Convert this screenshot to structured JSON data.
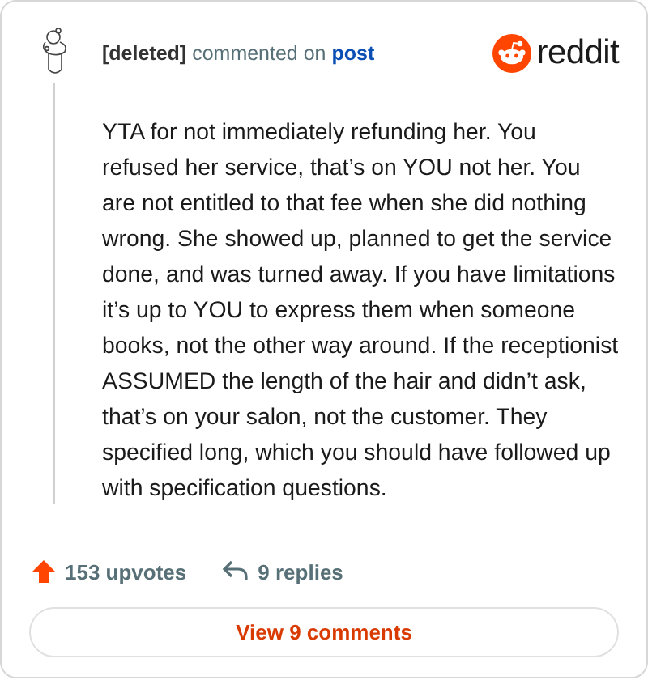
{
  "header": {
    "author": "[deleted]",
    "action": "commented on",
    "link": "post",
    "brand": "reddit"
  },
  "comment": {
    "text": "YTA for not immediately refunding her. You refused her service, that’s on YOU not her. You are not entitled to that fee when she did nothing wrong. She showed up, planned to get the service done, and was turned away. If you have limitations it’s up to YOU to express them when someone books, not the other way around. If the receptionist ASSUMED the length of the hair and didn’t ask, that’s on your salon, not the customer. They specified long, which you should have followed up with specification questions."
  },
  "footer": {
    "upvotes": "153 upvotes",
    "replies": "9 replies"
  },
  "button": "View 9 comments"
}
